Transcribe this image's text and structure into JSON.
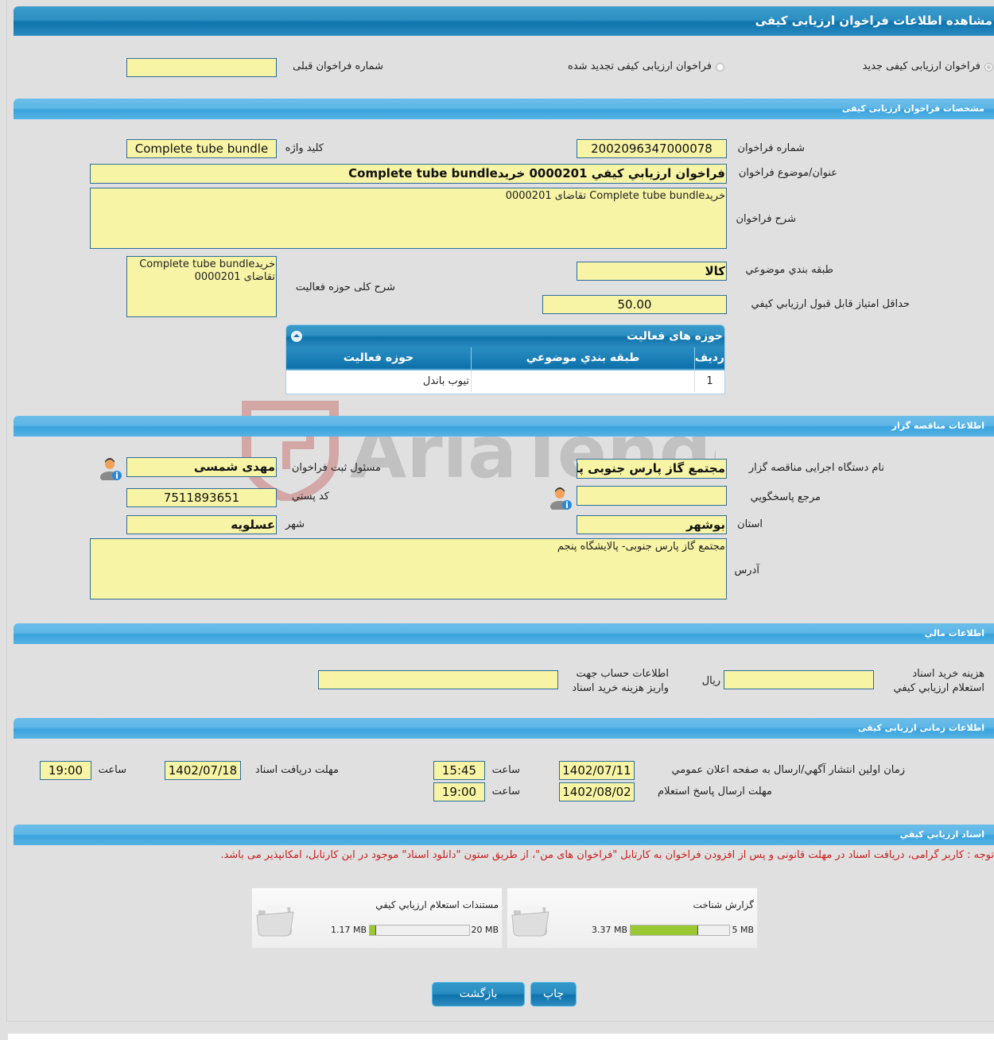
{
  "page": {
    "title": "مشاهده اطلاعات فراخوان ارزیابی کیفی"
  },
  "call_type": {
    "options": [
      {
        "label": "فراخوان ارزیابی کیفی جدید",
        "selected": true
      },
      {
        "label": "فراخوان ارزیابی کیفی تجدید شده",
        "selected": false
      }
    ],
    "previous_number_label": "شماره فراخوان قبلی",
    "previous_number_value": ""
  },
  "spec": {
    "section_title": "مشخصات فراخوان ارزیابی کیفی",
    "number_label": "شماره فراخوان",
    "number_value": "2002096347000078",
    "keyword_label": "کلید واژه",
    "keyword_value": "Complete tube bundle",
    "subject_label": "عنوان/موضوع فراخوان",
    "subject_value": "فراخوان ارزيابي كيفي 0000201 خریدComplete tube bundle",
    "description_label": "شرح فراخوان",
    "description_value": "خریدComplete tube bundle تقاضای 0000201",
    "category_label": "طبقه بندي موضوعي",
    "category_value": "كالا",
    "activity_desc_label": "شرح کلی حوزه فعالیت",
    "activity_desc_value": "خریدComplete tube bundle تقاضای 0000201",
    "min_score_label": "حداقل امتیاز قابل قبول ارزيابي كيفي",
    "min_score_value": "50.00"
  },
  "activity_grid": {
    "title": "حوزه های فعالیت",
    "columns": [
      "رديف",
      "طبقه بندي موضوعي",
      "حوزه فعالیت"
    ],
    "rows": [
      {
        "index": "1",
        "category": "",
        "activity": "تیوب باندل"
      }
    ]
  },
  "organizer": {
    "section_title": "اطلاعات مناقصه گزار",
    "org_name_label": "نام دستگاه اجرایی مناقصه گزار",
    "org_name_value": "مجتمع گاز پارس جنوبی  پالایشگاه پنجم",
    "registrar_label": "مسئول ثبت فراخوان",
    "registrar_value": "مهدی شمسی",
    "reference_label": "مرجع پاسخگويي",
    "reference_value": "",
    "postal_code_label": "كد پستي",
    "postal_code_value": "7511893651",
    "province_label": "استان",
    "province_value": "بوشهر",
    "city_label": "شهر",
    "city_value": "عسلویه",
    "address_label": "آدرس",
    "address_value": "مجتمع گاز پارس جنوبی- پالایشگاه پنجم"
  },
  "financial": {
    "section_title": "اطلاعات مالي",
    "fee_label_line1": "هزینه خرید اسناد",
    "fee_label_line2": "استعلام ارزيابي كيفي",
    "fee_value": "",
    "currency": "ريال",
    "account_label_line1": "اطلاعات حساب جهت",
    "account_label_line2": "واریز هزینه خرید اسناد",
    "account_value": ""
  },
  "timing": {
    "section_title": "اطلاعات زمانی ارزیابی کیفی",
    "publish_label": "زمان اولين انتشار آگهي/ارسال به صفحه اعلان عمومي",
    "publish_date": "1402/07/11",
    "publish_time": "15:45",
    "reply_deadline_label": "مهلت ارسال پاسخ استعلام",
    "reply_deadline_date": "1402/08/02",
    "reply_deadline_time": "19:00",
    "doc_deadline_label": "مهلت دریافت اسناد",
    "doc_deadline_date": "1402/07/18",
    "doc_deadline_time": "19:00",
    "time_label": "ساعت"
  },
  "documents": {
    "section_title": "اسناد ارزيابي كيفي",
    "notice": "توجه : کاربر گرامی، دریافت اسناد در مهلت قانونی و پس از افزودن فراخوان به کارتابل \"فراخوان های من\"، از طریق ستون \"دانلود اسناد\" موجود در این کارتابل، امکانپذیر می باشد.",
    "items": [
      {
        "title": "گزارش شناخت",
        "max": "5 MB",
        "used": "3.37 MB",
        "fraction": 0.674
      },
      {
        "title": "مستندات استعلام ارزيابي كيفي",
        "max": "20 MB",
        "used": "1.17 MB",
        "fraction": 0.0585
      }
    ]
  },
  "actions": {
    "print_label": "چاپ",
    "back_label": "بازگشت"
  },
  "colors": {
    "field_bg": "#f7f4a5",
    "field_border": "#2e6d9a",
    "header_blue": "#0e73ab",
    "section_blue": "#5db6e6",
    "notice_red": "#cc1c1c",
    "progress_green": "#9ac832"
  }
}
